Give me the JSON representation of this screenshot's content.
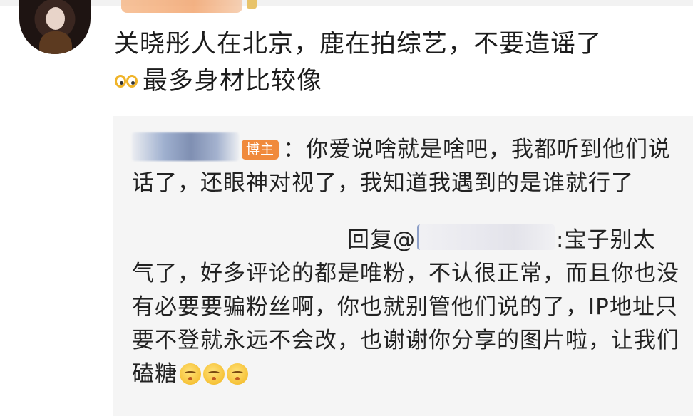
{
  "post": {
    "author_avatar": "avatar",
    "comment_line1": "关晓彤人在北京，鹿在拍综艺，不要造谣了",
    "comment_line2": "最多身材比较像",
    "comment_emoji": "crying-eyes-emoji"
  },
  "quote": {
    "author_tag": "博主",
    "reply1_text": "：你爱说啥就是啥吧，我都听到他们说话了，还眼神对视了，我知道我遇到的是谁就行了",
    "reply2_prefix": "回复@",
    "reply2_text_a": ":宝子别太",
    "reply2_text_b": "气了，好多评论的都是唯粉，不认很正常，而且你也没有必要要骗粉丝啊，你也就别管他们说的了，IP地址只要不登就永远不会改，也谢谢你分享的图片啦，让我们磕糖",
    "reply2_emoji": "kiss-face-emoji",
    "reply2_emoji_count": 3
  },
  "colors": {
    "tag_bg": "#f08a3c",
    "quote_bg": "#f5f5f5",
    "text": "#1c1c1c"
  }
}
